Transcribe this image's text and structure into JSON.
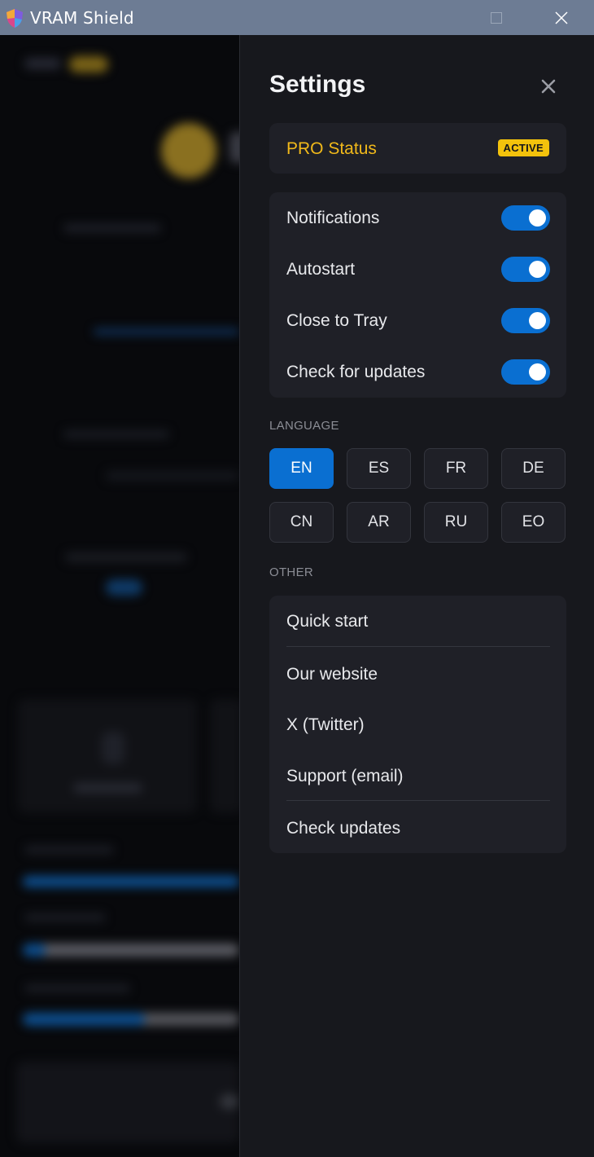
{
  "window": {
    "title": "VRAM Shield"
  },
  "settings": {
    "title": "Settings",
    "pro": {
      "label": "PRO Status",
      "badge": "ACTIVE"
    },
    "toggles": [
      {
        "label": "Notifications",
        "on": true
      },
      {
        "label": "Autostart",
        "on": true
      },
      {
        "label": "Close to Tray",
        "on": true
      },
      {
        "label": "Check for updates",
        "on": true
      }
    ],
    "language": {
      "heading": "LANGUAGE",
      "selected": "EN",
      "options": [
        "EN",
        "ES",
        "FR",
        "DE",
        "CN",
        "AR",
        "RU",
        "EO"
      ]
    },
    "other": {
      "heading": "OTHER",
      "items": [
        "Quick start",
        "Our website",
        "X (Twitter)",
        "Support (email)",
        "Check updates"
      ]
    }
  },
  "colors": {
    "accent": "#0a6fd1",
    "pro": "#f1b91a",
    "badge": "#f3c20c",
    "panel": "#17181d",
    "card": "#1f2027"
  }
}
